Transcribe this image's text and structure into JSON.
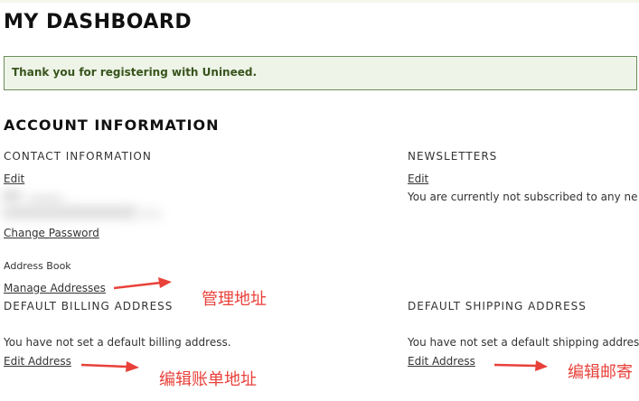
{
  "page": {
    "title": "MY DASHBOARD"
  },
  "message": {
    "success": "Thank you for registering with Unineed."
  },
  "account_info": {
    "title": "ACCOUNT INFORMATION",
    "contact": {
      "title": "CONTACT INFORMATION",
      "edit_label": "Edit",
      "change_password_label": "Change Password"
    },
    "newsletters": {
      "title": "NEWSLETTERS",
      "edit_label": "Edit",
      "status_text": "You are currently not subscribed to any ne"
    }
  },
  "address_book": {
    "label": "Address Book",
    "manage_label": "Manage Addresses",
    "billing": {
      "title": "DEFAULT BILLING ADDRESS",
      "status_text": "You have not set a default billing address.",
      "edit_label": "Edit Address"
    },
    "shipping": {
      "title": "DEFAULT SHIPPING ADDRESS",
      "status_text": "You have not set a default shipping addres",
      "edit_label": "Edit Address"
    }
  },
  "annotations": {
    "manage_addresses": "管理地址",
    "edit_billing": "编辑账单地址",
    "edit_shipping": "编辑邮寄",
    "color": "#e8413a"
  },
  "colors": {
    "success_bg": "#eef4e7",
    "success_border": "#6b8e5a",
    "success_text": "#38541d"
  }
}
